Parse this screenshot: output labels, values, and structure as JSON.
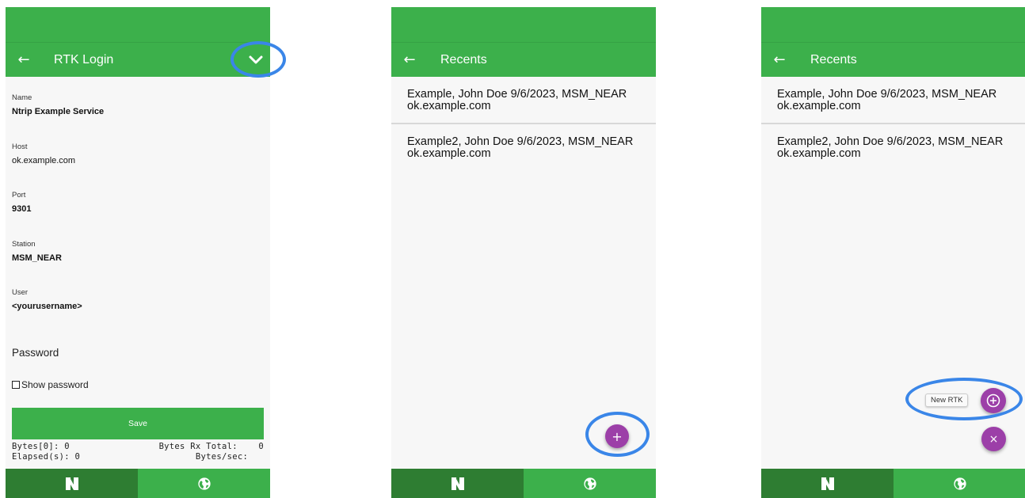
{
  "colors": {
    "appbar": "#3cb04b",
    "nav_active": "#2e7d32",
    "fab": "#9c3fa8",
    "highlight_ring": "#3a86e8"
  },
  "screen1": {
    "title": "RTK Login",
    "back_icon": "arrow-left-icon",
    "menu_icon": "chevron-down-icon",
    "fields": [
      {
        "label": "Name",
        "value": "Ntrip Example Service"
      },
      {
        "label": "Host",
        "value": "ok.example.com"
      },
      {
        "label": "Port",
        "value": "9301"
      },
      {
        "label": "Station",
        "value": "MSM_NEAR"
      },
      {
        "label": "User",
        "value": "<yourusername>"
      }
    ],
    "password_placeholder": "Password",
    "show_password": "Show password",
    "save": "Save",
    "stats": {
      "bytes0": "Bytes[0]: 0",
      "rx_total": "Bytes Rx Total:    0",
      "elapsed": "Elapsed(s): 0",
      "bytes_sec": "Bytes/sec:   "
    }
  },
  "recents": {
    "title": "Recents",
    "items": [
      {
        "line1": "Example, John Doe 9/6/2023, MSM_NEAR",
        "line2": "ok.example.com"
      },
      {
        "line1": "Example2, John Doe 9/6/2023, MSM_NEAR",
        "line2": "ok.example.com"
      }
    ],
    "fab_add": "+",
    "new_rtk_label": "New RTK",
    "fab_close": "×"
  },
  "bottom_nav": {
    "left_icon": "ntrip-logo-icon",
    "right_icon": "globe-icon"
  }
}
